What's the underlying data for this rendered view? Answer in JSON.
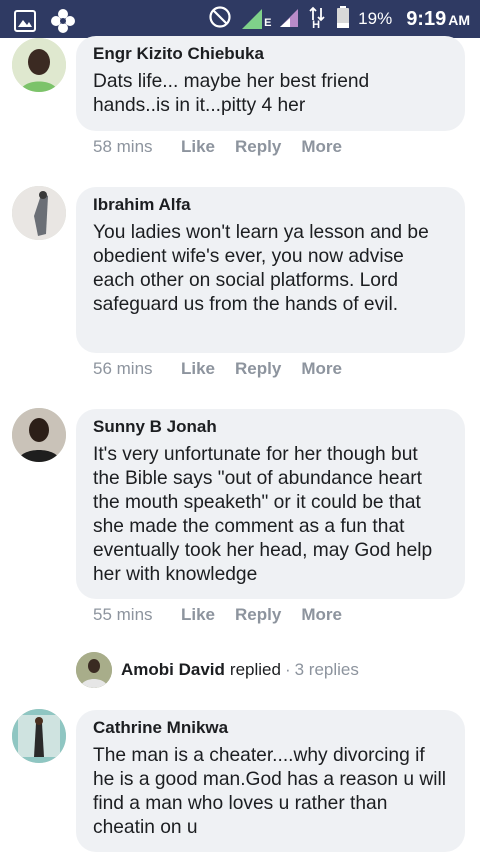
{
  "status_bar": {
    "battery_percent": "19%",
    "time": "9:19",
    "ampm": "AM",
    "network_letter_1": "E",
    "network_letter_2": "H",
    "left_icons": [
      "image-icon",
      "settings-flower-icon"
    ],
    "right_icons": [
      "do-not-disturb-icon",
      "signal-icon",
      "signal-icon",
      "data-arrows-icon",
      "battery-icon"
    ]
  },
  "actions": {
    "like": "Like",
    "reply": "Reply",
    "more": "More"
  },
  "comments": [
    {
      "author": "Engr Kizito Chiebuka",
      "text": "Dats life... maybe her best friend hands..is in it...pitty 4 her",
      "time": "58 mins"
    },
    {
      "author": "Ibrahim Alfa",
      "text": "You ladies won't learn ya lesson and be obedient wife's ever, you now advise each other on social platforms. Lord safeguard us from the hands of evil.",
      "time": "56 mins"
    },
    {
      "author": "Sunny B Jonah",
      "text": "It's very unfortunate for her though but the Bible says \"out of abundance heart the mouth speaketh\" or it could be that she made the comment as a fun that eventually took her head, may God help her with knowledge",
      "time": "55 mins"
    },
    {
      "author": "Cathrine Mnikwa",
      "text": "The man is a cheater....why divorcing if he is a good man.God has a reason u will find a man who loves u rather than cheatin on u"
    }
  ],
  "replied": {
    "name": "Amobi David",
    "word": "replied",
    "dot": "·",
    "count": "3 replies"
  },
  "colors": {
    "status_bar": "#2f3a63",
    "bubble": "#eff1f4",
    "meta_text": "#8d949e",
    "primary_text": "#1c1e21"
  }
}
